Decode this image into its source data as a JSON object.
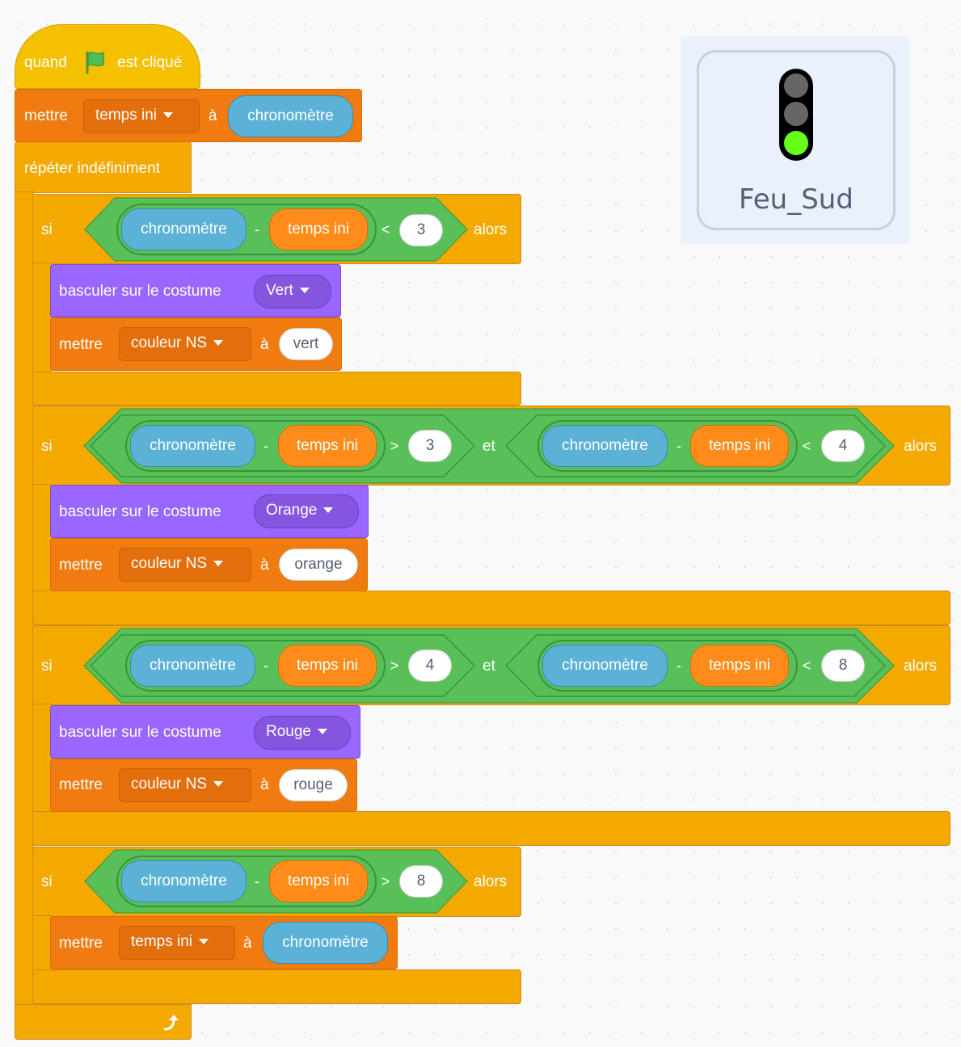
{
  "script": {
    "hat": {
      "when": "quand",
      "clicked": "est cliqué"
    },
    "set_initial": {
      "set": "mettre",
      "variable": "temps ini",
      "to": "à",
      "reporter": "chronomètre"
    },
    "forever": {
      "label": "répéter indéfiniment"
    },
    "if1": {
      "if": "si",
      "then": "alors",
      "cond": {
        "timer": "chronomètre",
        "minus": "-",
        "var": "temps ini",
        "op": "<",
        "value": "3"
      },
      "costume": {
        "label": "basculer sur le costume",
        "value": "Vert"
      },
      "set": {
        "set": "mettre",
        "variable": "couleur NS",
        "to": "à",
        "value": "vert"
      }
    },
    "if2": {
      "if": "si",
      "then": "alors",
      "and": "et",
      "cond_a": {
        "timer": "chronomètre",
        "minus": "-",
        "var": "temps ini",
        "op": ">",
        "value": "3"
      },
      "cond_b": {
        "timer": "chronomètre",
        "minus": "-",
        "var": "temps ini",
        "op": "<",
        "value": "4"
      },
      "costume": {
        "label": "basculer sur le costume",
        "value": "Orange"
      },
      "set": {
        "set": "mettre",
        "variable": "couleur NS",
        "to": "à",
        "value": "orange"
      }
    },
    "if3": {
      "if": "si",
      "then": "alors",
      "and": "et",
      "cond_a": {
        "timer": "chronomètre",
        "minus": "-",
        "var": "temps ini",
        "op": ">",
        "value": "4"
      },
      "cond_b": {
        "timer": "chronomètre",
        "minus": "-",
        "var": "temps ini",
        "op": "<",
        "value": "8"
      },
      "costume": {
        "label": "basculer sur le costume",
        "value": "Rouge"
      },
      "set": {
        "set": "mettre",
        "variable": "couleur NS",
        "to": "à",
        "value": "rouge"
      }
    },
    "if4": {
      "if": "si",
      "then": "alors",
      "cond": {
        "timer": "chronomètre",
        "minus": "-",
        "var": "temps ini",
        "op": ">",
        "value": "8"
      },
      "set": {
        "set": "mettre",
        "variable": "temps ini",
        "to": "à",
        "reporter": "chronomètre"
      }
    }
  },
  "sprite": {
    "name": "Feu_Sud"
  },
  "colors": {
    "control": "#f4a900",
    "events": "#f4c000",
    "variables": "#f07b10",
    "looks": "#9966ff",
    "operators": "#59c059",
    "sensing": "#5cb1d6"
  },
  "icons": {
    "flag": "green-flag-icon",
    "loop": "loop-arrow-icon",
    "traffic_light": "traffic-light-icon"
  }
}
